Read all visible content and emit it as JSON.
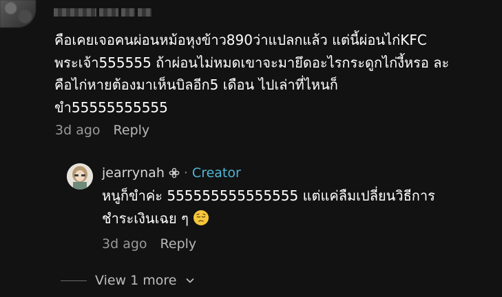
{
  "comment": {
    "text": "คือเคยเจอคนผ่อนหม้อหุงข้าว890ว่าแปลกแล้ว แต่นี้ผ่อนไก่KFC\nพระเจ้า555555 ถ้าผ่อนไม่หมดเขาจะมายึดอะไรกระดูกไก่งี้หรอ ละ\nคือไก่หายต้องมาเห็นบิลอีก5 เดือน ไปเล่าที่ไหนก็\nขำ55555555555",
    "time": "3d ago",
    "reply_label": "Reply"
  },
  "reply": {
    "username": "jearrynah",
    "separator": "·",
    "badge": "Creator",
    "text": "หนูก็ขำค่ะ 555555555555555 แต่แค่ลืมเปลี่ยนวิธีการ\nชำระเงินเฉย ๆ",
    "emoji": "pensive-face-icon",
    "time": "3d ago",
    "reply_label": "Reply"
  },
  "view_more": {
    "label": "View 1 more"
  },
  "colors": {
    "background": "#121212",
    "creator": "#4fb6d6",
    "muted": "#9a9a9a"
  }
}
